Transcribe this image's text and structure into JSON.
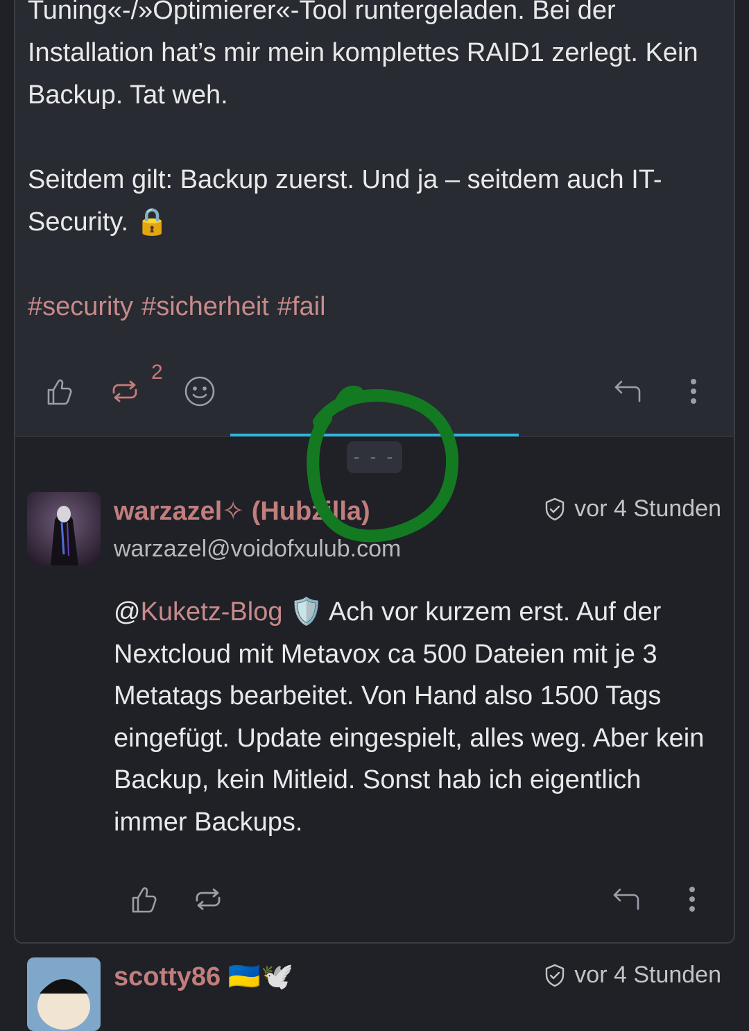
{
  "post1": {
    "lines": [
      "Tuning«-/»Optimierer«-Tool runtergeladen. Bei der Installation hat’s mir mein komplettes RAID1 zerlegt. Kein Backup. Tat weh.",
      "Seitdem gilt: Backup zuerst. Und ja – seitdem auch IT-Security."
    ],
    "lock_emoji": "🔒",
    "hashtags": [
      "#security",
      "#sicherheit",
      "#fail"
    ],
    "boost_count": "2"
  },
  "collapse": {
    "label": "- - -"
  },
  "reply": {
    "author_name": "warzazel✧ (Hubzilla)",
    "handle": "warzazel@voidofxulub.com",
    "time": "vor 4 Stunden",
    "mention": "@Kuketz-Blog",
    "mention_prefix": "@",
    "mention_name": "Kuketz-Blog",
    "shield_emoji": "🛡️",
    "text": "Ach vor kurzem erst. Auf der Nextcloud mit Metavox ca 500 Dateien mit je 3 Metatags bearbeitet. Von Hand also 1500 Tags eingefügt. Update eingespielt, alles weg. Aber kein Backup, kein Mitleid. Sonst hab ich eigentlich immer Backups."
  },
  "next_post": {
    "author_name": "scotty86",
    "flags": "🇺🇦🕊️",
    "time": "vor 4 Stunden"
  },
  "colors": {
    "accent_link": "#c98a8a",
    "indicator": "#2bb7e0",
    "annotation_green": "#137a22"
  },
  "icons": [
    "thumbs-up-icon",
    "boost-icon",
    "emoji-react-icon",
    "reply-icon",
    "more-icon",
    "shield-check-icon"
  ]
}
